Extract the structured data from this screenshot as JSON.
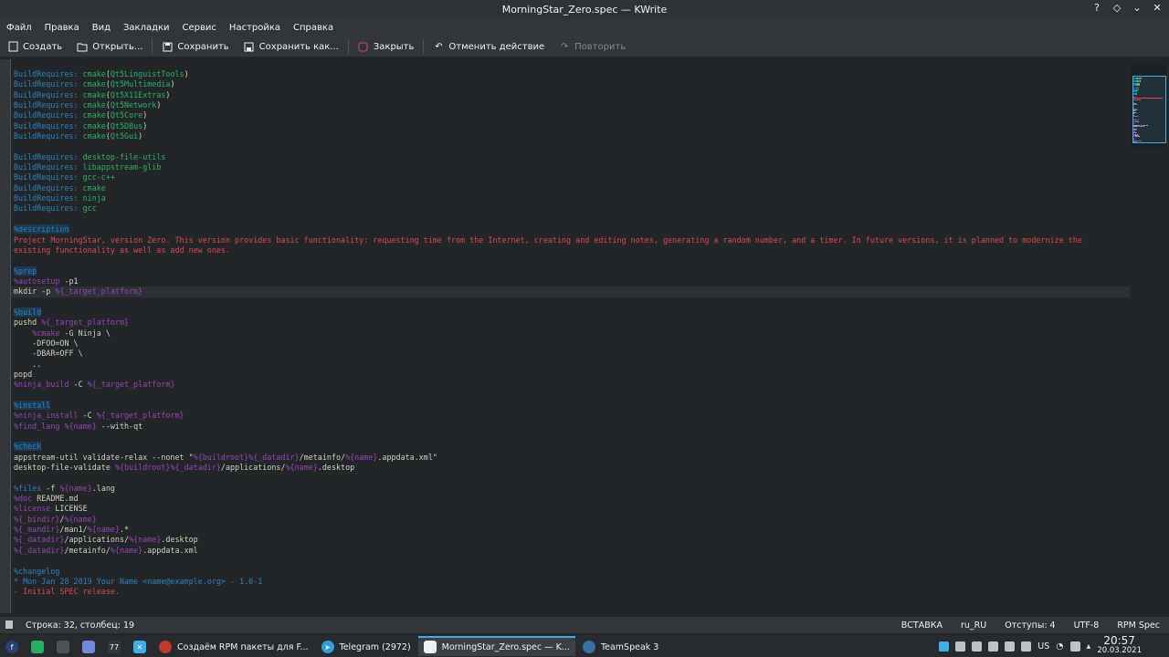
{
  "window": {
    "title": "MorningStar_Zero.spec — KWrite"
  },
  "menu": [
    "Файл",
    "Правка",
    "Вид",
    "Закладки",
    "Сервис",
    "Настройка",
    "Справка"
  ],
  "toolbar": {
    "new": "Создать",
    "open": "Открыть...",
    "save": "Сохранить",
    "save_as": "Сохранить как...",
    "close": "Закрыть",
    "undo": "Отменить действие",
    "redo": "Повторить"
  },
  "code_lines": [
    [
      [
        "kw",
        "BuildRequires: "
      ],
      [
        "gr",
        "cmake"
      ],
      [
        "",
        "("
      ],
      [
        "gr",
        "Qt5LinguistTools"
      ],
      [
        "",
        ")"
      ]
    ],
    [
      [
        "kw",
        "BuildRequires: "
      ],
      [
        "gr",
        "cmake"
      ],
      [
        "",
        "("
      ],
      [
        "gr",
        "Qt5Multimedia"
      ],
      [
        "",
        ")"
      ]
    ],
    [
      [
        "kw",
        "BuildRequires: "
      ],
      [
        "gr",
        "cmake"
      ],
      [
        "",
        "("
      ],
      [
        "gr",
        "Qt5X11Extras"
      ],
      [
        "",
        ")"
      ]
    ],
    [
      [
        "kw",
        "BuildRequires: "
      ],
      [
        "gr",
        "cmake"
      ],
      [
        "",
        "("
      ],
      [
        "gr",
        "Qt5Network"
      ],
      [
        "",
        ")"
      ]
    ],
    [
      [
        "kw",
        "BuildRequires: "
      ],
      [
        "gr",
        "cmake"
      ],
      [
        "",
        "("
      ],
      [
        "gr",
        "Qt5Core"
      ],
      [
        "",
        ")"
      ]
    ],
    [
      [
        "kw",
        "BuildRequires: "
      ],
      [
        "gr",
        "cmake"
      ],
      [
        "",
        "("
      ],
      [
        "gr",
        "Qt5DBus"
      ],
      [
        "",
        ")"
      ]
    ],
    [
      [
        "kw",
        "BuildRequires: "
      ],
      [
        "gr",
        "cmake"
      ],
      [
        "",
        "("
      ],
      [
        "gr",
        "Qt5Gui"
      ],
      [
        "",
        ")"
      ]
    ],
    [],
    [
      [
        "kw",
        "BuildRequires: "
      ],
      [
        "gr",
        "desktop-file-utils"
      ]
    ],
    [
      [
        "kw",
        "BuildRequires: "
      ],
      [
        "gr",
        "libappstream-glib"
      ]
    ],
    [
      [
        "kw",
        "BuildRequires: "
      ],
      [
        "gr",
        "gcc-c++"
      ]
    ],
    [
      [
        "kw",
        "BuildRequires: "
      ],
      [
        "gr",
        "cmake"
      ]
    ],
    [
      [
        "kw",
        "BuildRequires: "
      ],
      [
        "gr",
        "ninja"
      ]
    ],
    [
      [
        "kw",
        "BuildRequires: "
      ],
      [
        "gr",
        "gcc"
      ]
    ],
    [],
    [
      [
        "sec",
        "%description"
      ]
    ],
    [
      [
        "red",
        "Project MorningStar, version Zero. This version provides basic functionality: requesting time from the Internet, creating and editing notes, generating a random number, and a timer. In future versions, it is planned to modernize the"
      ]
    ],
    [
      [
        "red",
        "existing functionality as well as add new ones."
      ]
    ],
    [],
    [
      [
        "sec",
        "%prep"
      ]
    ],
    [
      [
        "mac",
        "%autosetup"
      ],
      [
        "",
        " -p1"
      ]
    ],
    [
      [
        "",
        "mkdir -p "
      ],
      [
        "mac",
        "%{_target_platform}"
      ]
    ],
    [],
    [
      [
        "sec",
        "%build"
      ]
    ],
    [
      [
        "",
        "pushd "
      ],
      [
        "mac",
        "%{_target_platform}"
      ]
    ],
    [
      [
        "",
        "    "
      ],
      [
        "mac",
        "%cmake"
      ],
      [
        "",
        " -G Ninja \\"
      ]
    ],
    [
      [
        "",
        "    -DFOO=ON \\"
      ]
    ],
    [
      [
        "",
        "    -DBAR=OFF \\"
      ]
    ],
    [
      [
        "",
        "    .."
      ]
    ],
    [
      [
        "",
        "popd"
      ]
    ],
    [
      [
        "mac",
        "%ninja_build"
      ],
      [
        "",
        " -C "
      ],
      [
        "mac",
        "%{_target_platform}"
      ]
    ],
    [],
    [
      [
        "sec",
        "%install"
      ]
    ],
    [
      [
        "mac",
        "%ninja_install"
      ],
      [
        "",
        " -C "
      ],
      [
        "mac",
        "%{_target_platform}"
      ]
    ],
    [
      [
        "mac",
        "%find_lang"
      ],
      [
        "",
        " "
      ],
      [
        "mac",
        "%{name}"
      ],
      [
        "",
        " --with-qt"
      ]
    ],
    [],
    [
      [
        "sec",
        "%check"
      ]
    ],
    [
      [
        "",
        "appstream-util validate-relax --nonet \""
      ],
      [
        "mac",
        "%{buildroot}%{_datadir}"
      ],
      [
        "",
        "/metainfo/"
      ],
      [
        "mac",
        "%{name}"
      ],
      [
        "",
        ".appdata.xml\""
      ]
    ],
    [
      [
        "",
        "desktop-file-validate "
      ],
      [
        "mac",
        "%{buildroot}%{_datadir}"
      ],
      [
        "",
        "/applications/"
      ],
      [
        "mac",
        "%{name}"
      ],
      [
        "",
        ".desktop"
      ]
    ],
    [],
    [
      [
        "kw",
        "%files"
      ],
      [
        "",
        " -f "
      ],
      [
        "mac",
        "%{name}"
      ],
      [
        "",
        ".lang"
      ]
    ],
    [
      [
        "mac",
        "%doc"
      ],
      [
        "",
        " README.md"
      ]
    ],
    [
      [
        "mac",
        "%license"
      ],
      [
        "",
        " LICENSE"
      ]
    ],
    [
      [
        "mac",
        "%{_bindir}"
      ],
      [
        "",
        "/"
      ],
      [
        "mac",
        "%{name}"
      ]
    ],
    [
      [
        "mac",
        "%{_mandir}"
      ],
      [
        "",
        "/man1/"
      ],
      [
        "mac",
        "%{name}"
      ],
      [
        "",
        ".*"
      ]
    ],
    [
      [
        "mac",
        "%{_datadir}"
      ],
      [
        "",
        "/applications/"
      ],
      [
        "mac",
        "%{name}"
      ],
      [
        "",
        ".desktop"
      ]
    ],
    [
      [
        "mac",
        "%{_datadir}"
      ],
      [
        "",
        "/metainfo/"
      ],
      [
        "mac",
        "%{name}"
      ],
      [
        "",
        ".appdata.xml"
      ]
    ],
    [],
    [
      [
        "kw",
        "%changelog"
      ]
    ],
    [
      [
        "kw",
        "* Mon Jan 28 2019 Your Name <name@example.org> - 1.0-1"
      ]
    ],
    [
      [
        "red",
        "- Initial SPEC release."
      ]
    ]
  ],
  "current_line_index": 21,
  "status": {
    "position": "Строка: 32, столбец: 19",
    "mode": "ВСТАВКА",
    "lang": "ru_RU",
    "indent": "Отступы: 4",
    "encoding": "UTF-8",
    "syntax": "RPM Spec"
  },
  "taskbar": {
    "tasks": [
      {
        "label": "Создаём RPM пакеты для F...",
        "icon": "browser-icon",
        "color": "#c0392b"
      },
      {
        "label": "Telegram (2972)",
        "icon": "telegram-icon",
        "color": "#2aa1da"
      },
      {
        "label": "MorningStar_Zero.spec — K...",
        "icon": "kwrite-icon",
        "color": "#eff0f1"
      },
      {
        "label": "TeamSpeak 3",
        "icon": "teamspeak-icon",
        "color": "#3a6ea5"
      }
    ],
    "keyboard": "US",
    "time": "20:57",
    "date": "20.03.2021"
  }
}
